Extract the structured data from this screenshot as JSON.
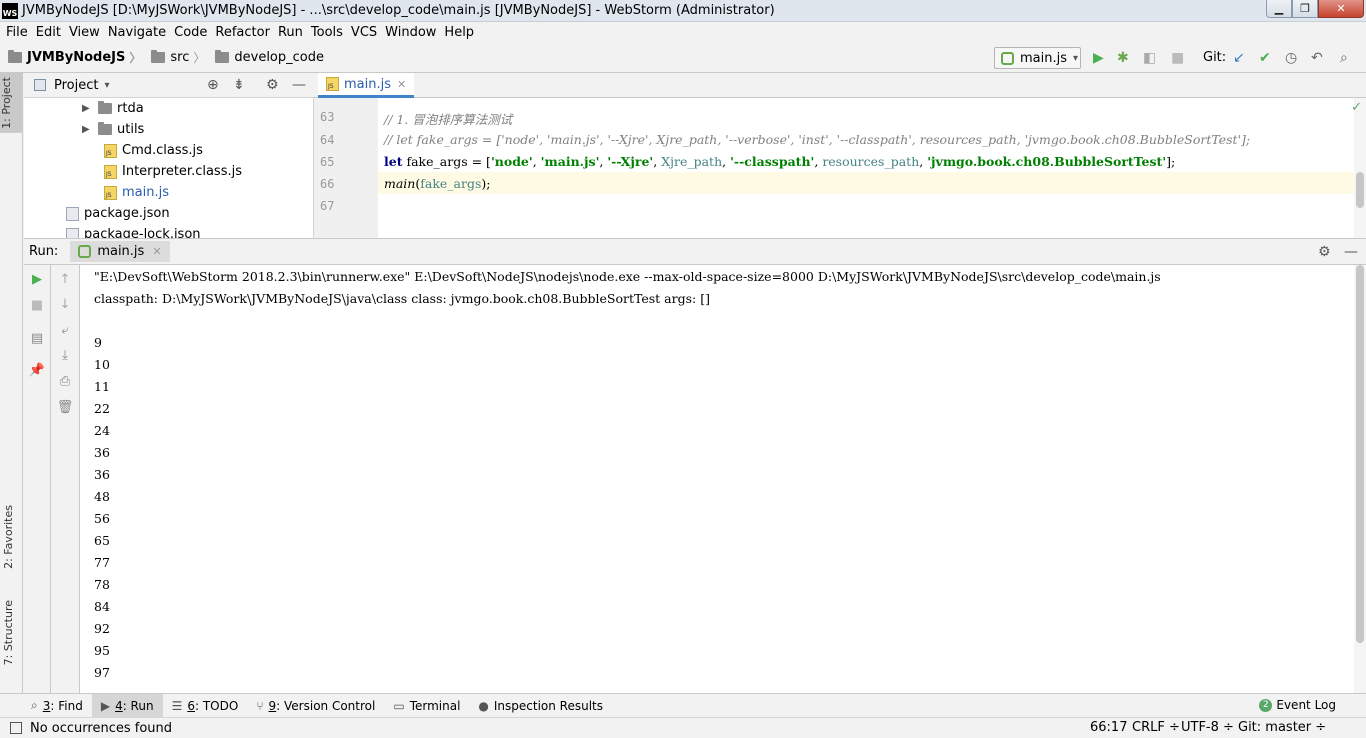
{
  "window": {
    "title": "JVMByNodeJS [D:\\MyJSWork\\JVMByNodeJS] - ...\\src\\develop_code\\main.js [JVMByNodeJS] - WebStorm (Administrator)",
    "logo": "WS",
    "min": "▁",
    "max": "❐",
    "close": "✕"
  },
  "menu": [
    "File",
    "Edit",
    "View",
    "Navigate",
    "Code",
    "Refactor",
    "Run",
    "Tools",
    "VCS",
    "Window",
    "Help"
  ],
  "breadcrumb": [
    "JVMByNodeJS",
    "src",
    "develop_code"
  ],
  "toolbar": {
    "run_config": "main.js",
    "git_label": "Git:"
  },
  "side_tabs": {
    "project": "1: Project",
    "favorites": "2: Favorites",
    "structure": "7: Structure"
  },
  "project_panel": {
    "title": "Project",
    "tree": [
      {
        "label": "rtda",
        "kind": "folder"
      },
      {
        "label": "utils",
        "kind": "folder"
      },
      {
        "label": "Cmd.class.js",
        "kind": "js"
      },
      {
        "label": "Interpreter.class.js",
        "kind": "js"
      },
      {
        "label": "main.js",
        "kind": "js"
      },
      {
        "label": "package.json",
        "kind": "json"
      },
      {
        "label": "package-lock.json",
        "kind": "json"
      }
    ]
  },
  "editor": {
    "tab": "main.js",
    "line_numbers": [
      "63",
      "64",
      "65",
      "66",
      "67"
    ],
    "lines": {
      "l63": "// 1. 冒泡排序算法测试",
      "l64": "// let fake_args = ['node', 'main.js', '--Xjre', Xjre_path, '--verbose', 'inst', '--classpath', resources_path, 'jvmgo.book.ch08.BubbleSortTest'];",
      "l65_kw": "let",
      "l65_var": "fake_args",
      "l65_eq": " = [",
      "l65_s1": "'node'",
      "l65_s2": "'main.js'",
      "l65_s3": "'--Xjre'",
      "l65_id1": "Xjre_path",
      "l65_s4": "'--classpath'",
      "l65_id2": "resources_path",
      "l65_s5": "'jvmgo.book.ch08.BubbleSortTest'",
      "l65_end": "];",
      "comma": ", ",
      "l66_fn": "main",
      "l66_open": "(",
      "l66_arg": "fake_args",
      "l66_close": ");"
    }
  },
  "run_panel": {
    "label": "Run:",
    "tab": "main.js",
    "console": [
      "\"E:\\DevSoft\\WebStorm 2018.2.3\\bin\\runnerw.exe\" E:\\DevSoft\\NodeJS\\nodejs\\node.exe --max-old-space-size=8000 D:\\MyJSWork\\JVMByNodeJS\\src\\develop_code\\main.js",
      "classpath: D:\\MyJSWork\\JVMByNodeJS\\java\\class class: jvmgo.book.ch08.BubbleSortTest args: []",
      "",
      "9",
      "10",
      "11",
      "22",
      "24",
      "36",
      "36",
      "48",
      "56",
      "65",
      "77",
      "78",
      "84",
      "92",
      "95",
      "97"
    ]
  },
  "bottom_tabs": [
    {
      "num": "3",
      "rest": ": Find"
    },
    {
      "num": "4",
      "rest": ": Run"
    },
    {
      "num": "6",
      "rest": ": TODO"
    },
    {
      "num": "9",
      "rest": ": Version Control"
    },
    {
      "num": "",
      "rest": "Terminal"
    },
    {
      "num": "",
      "rest": "Inspection Results"
    }
  ],
  "event_log": {
    "count": "2",
    "label": "Event Log"
  },
  "status": {
    "message": "No occurrences found",
    "position": "66:17",
    "line_sep": "CRLF ÷",
    "encoding": "UTF-8 ÷",
    "git": "Git: master ÷"
  }
}
